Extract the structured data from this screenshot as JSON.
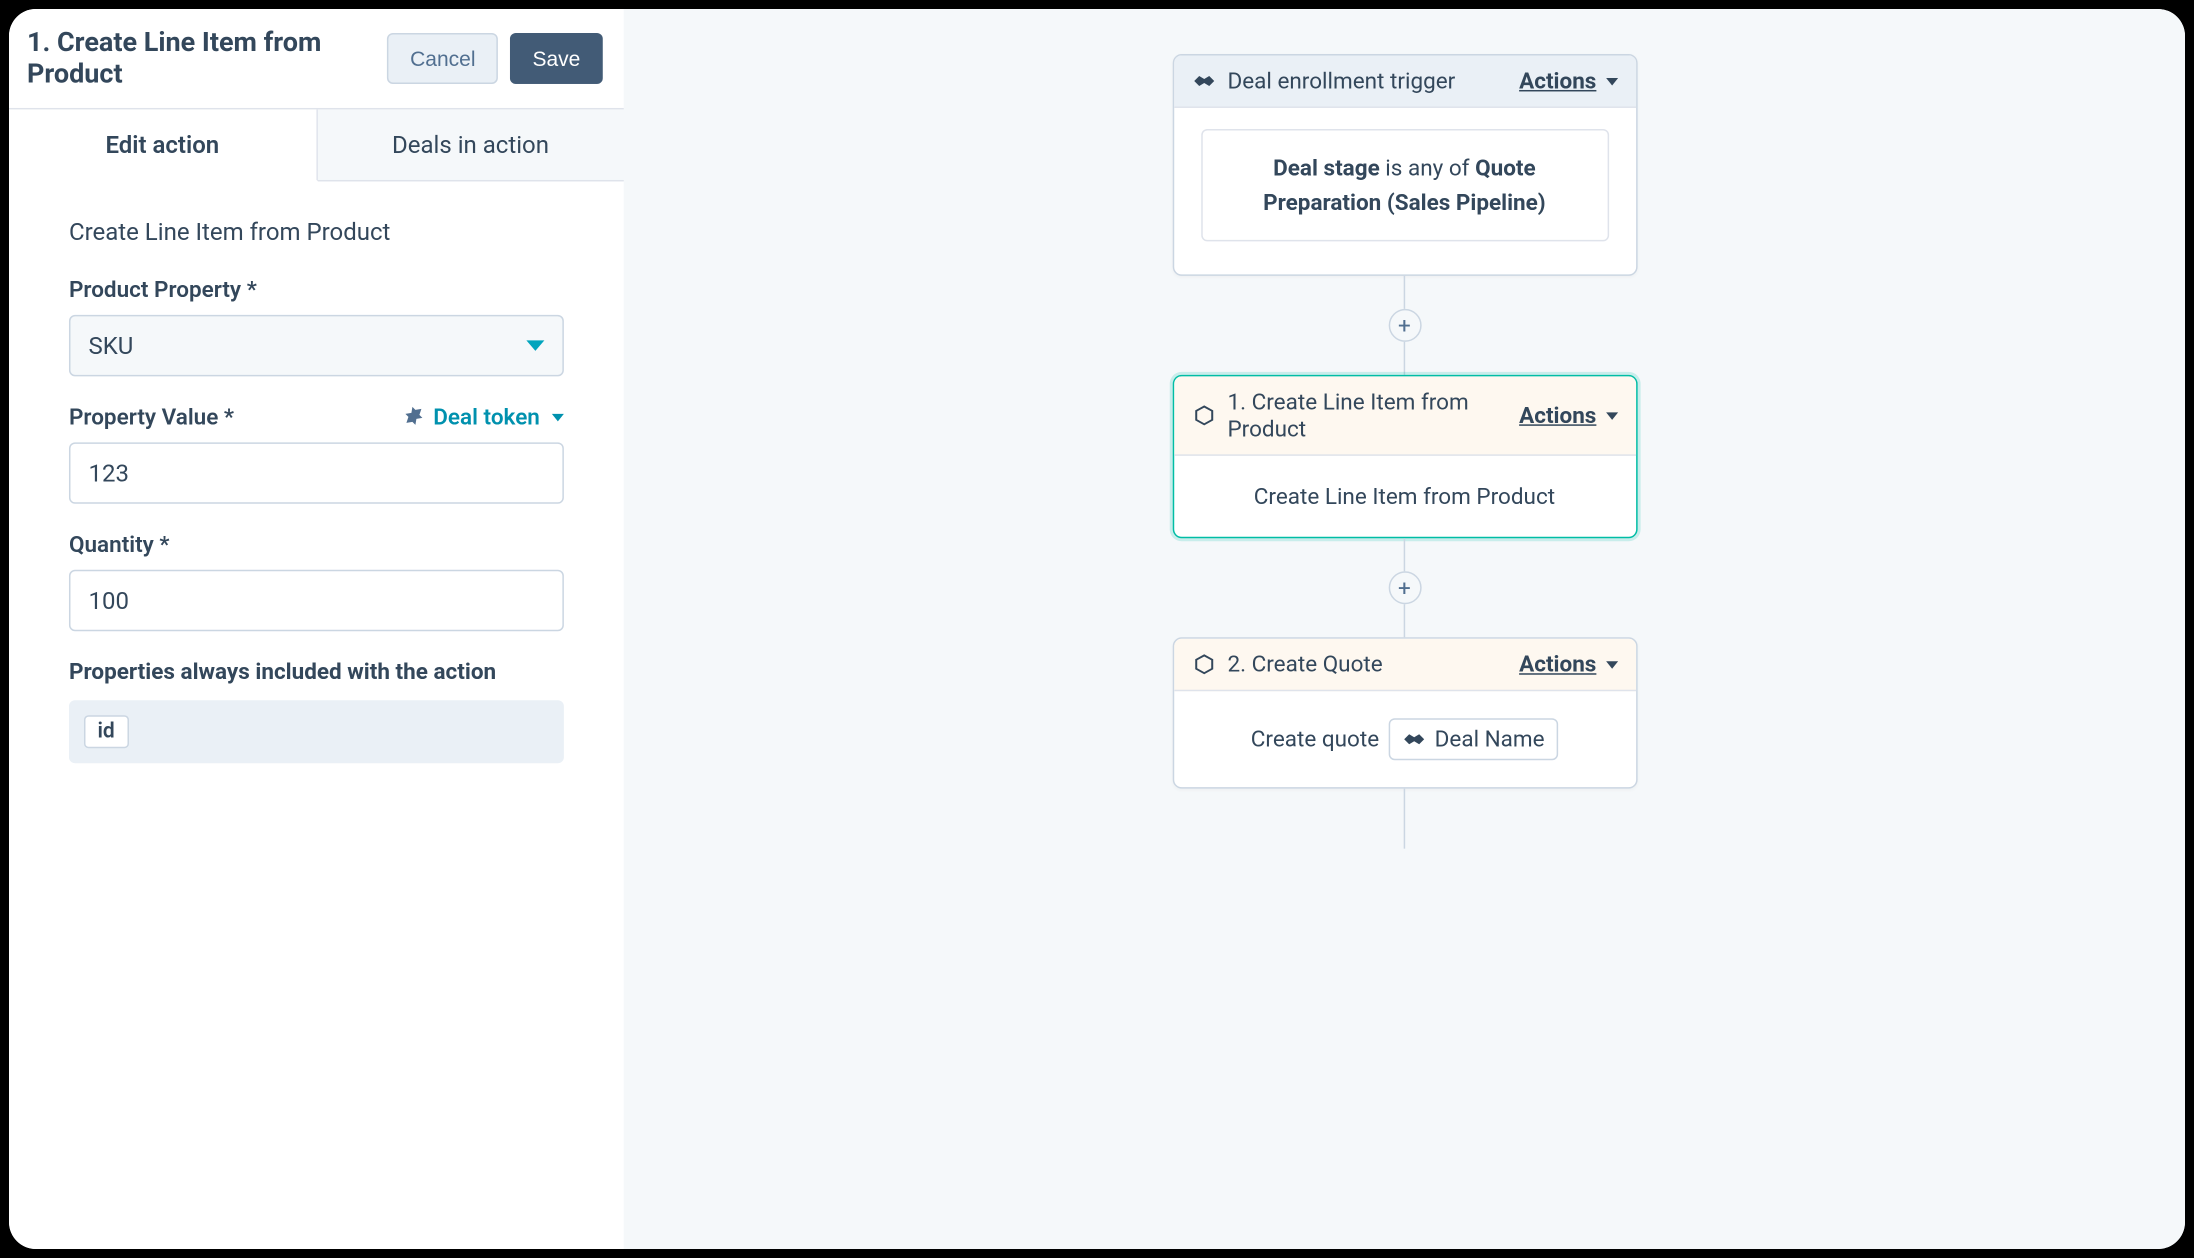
{
  "panel": {
    "title": "1. Create Line Item from Product",
    "cancel_label": "Cancel",
    "save_label": "Save",
    "tabs": {
      "edit": "Edit action",
      "deals": "Deals in action"
    },
    "subtitle": "Create Line Item from Product",
    "fields": {
      "product_property": {
        "label": "Product Property *",
        "value": "SKU"
      },
      "property_value": {
        "label": "Property Value *",
        "value": "123",
        "token_link": "Deal token"
      },
      "quantity": {
        "label": "Quantity *",
        "value": "100"
      }
    },
    "always_included_heading": "Properties always included with the action",
    "always_included": [
      "id"
    ]
  },
  "canvas": {
    "trigger": {
      "title": "Deal enrollment trigger",
      "actions_label": "Actions",
      "condition": {
        "subject": "Deal stage",
        "op": " is any of ",
        "value": "Quote Preparation (Sales Pipeline)"
      }
    },
    "step1": {
      "header": "1. Create Line Item from Product",
      "actions_label": "Actions",
      "body": "Create Line Item from Product"
    },
    "step2": {
      "header": "2. Create Quote",
      "actions_label": "Actions",
      "body_prefix": "Create quote",
      "token": "Deal Name"
    },
    "add_label": "+"
  }
}
